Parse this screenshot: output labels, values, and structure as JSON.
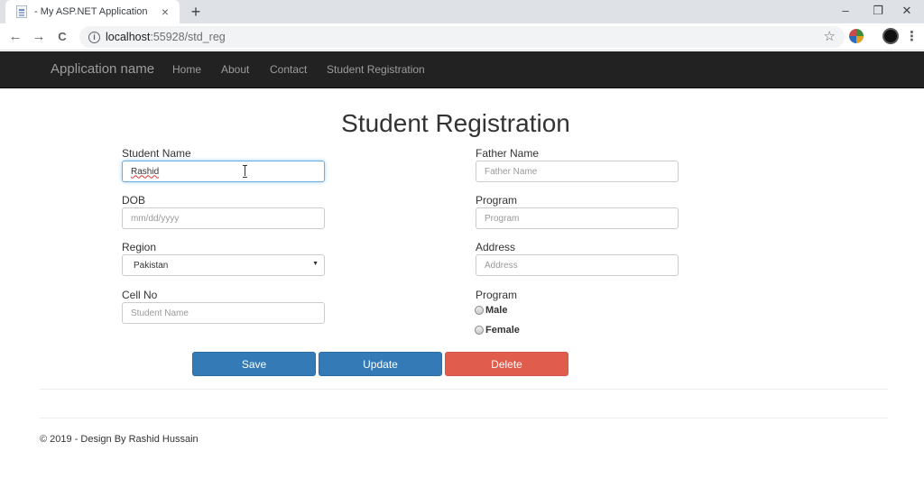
{
  "browser": {
    "tab_title": "- My ASP.NET Application",
    "tab_close": "×",
    "new_tab": "+",
    "minimize": "–",
    "maximize": "❐",
    "close": "✕",
    "url_host": "localhost",
    "url_path": ":55928/std_reg",
    "back": "←",
    "forward": "→",
    "reload": "C",
    "star": "☆",
    "menu": "⋮"
  },
  "navbar": {
    "brand": "Application name",
    "links": [
      "Home",
      "About",
      "Contact",
      "Student Registration"
    ]
  },
  "form": {
    "title": "Student Registration",
    "student_name": {
      "label": "Student Name",
      "value": "Rashid"
    },
    "dob": {
      "label": "DOB",
      "placeholder": "mm/dd/yyyy"
    },
    "region": {
      "label": "Region",
      "selected": "Pakistan"
    },
    "cell_no": {
      "label": "Cell No",
      "placeholder": "Student Name"
    },
    "father_name": {
      "label": "Father Name",
      "placeholder": "Father Name"
    },
    "program": {
      "label": "Program",
      "placeholder": "Program"
    },
    "address": {
      "label": "Address",
      "placeholder": "Address"
    },
    "gender": {
      "label": "Program",
      "options": [
        "Male",
        "Female"
      ]
    },
    "buttons": {
      "save": "Save",
      "update": "Update",
      "delete": "Delete"
    }
  },
  "footer": {
    "text": "© 2019 - Design By Rashid Hussain"
  },
  "colors": {
    "navbar_bg": "#222222",
    "primary": "#337ab7",
    "danger": "#e05c4c"
  }
}
